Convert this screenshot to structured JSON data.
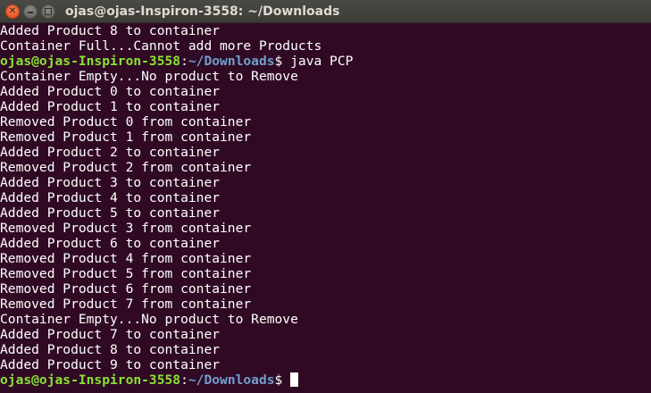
{
  "window": {
    "title": "ojas@ojas-Inspiron-3558: ~/Downloads",
    "close_glyph": "✕"
  },
  "prompt": {
    "user_host": "ojas@ojas-Inspiron-3558",
    "sep": ":",
    "path": "~/Downloads",
    "symbol": "$"
  },
  "lines": [
    {
      "type": "out",
      "text": "Added Product 8 to container"
    },
    {
      "type": "out",
      "text": "Container Full...Cannot add more Products"
    },
    {
      "type": "prompt",
      "command": " java PCP"
    },
    {
      "type": "out",
      "text": "Container Empty...No product to Remove"
    },
    {
      "type": "out",
      "text": "Added Product 0 to container"
    },
    {
      "type": "out",
      "text": "Added Product 1 to container"
    },
    {
      "type": "out",
      "text": "Removed Product 0 from container"
    },
    {
      "type": "out",
      "text": "Removed Product 1 from container"
    },
    {
      "type": "out",
      "text": "Added Product 2 to container"
    },
    {
      "type": "out",
      "text": "Removed Product 2 from container"
    },
    {
      "type": "out",
      "text": "Added Product 3 to container"
    },
    {
      "type": "out",
      "text": "Added Product 4 to container"
    },
    {
      "type": "out",
      "text": "Added Product 5 to container"
    },
    {
      "type": "out",
      "text": "Removed Product 3 from container"
    },
    {
      "type": "out",
      "text": "Added Product 6 to container"
    },
    {
      "type": "out",
      "text": "Removed Product 4 from container"
    },
    {
      "type": "out",
      "text": "Removed Product 5 from container"
    },
    {
      "type": "out",
      "text": "Removed Product 6 from container"
    },
    {
      "type": "out",
      "text": "Removed Product 7 from container"
    },
    {
      "type": "out",
      "text": "Container Empty...No product to Remove"
    },
    {
      "type": "out",
      "text": "Added Product 7 to container"
    },
    {
      "type": "out",
      "text": "Added Product 8 to container"
    },
    {
      "type": "out",
      "text": "Added Product 9 to container"
    },
    {
      "type": "prompt",
      "command": " ",
      "cursor": true
    }
  ],
  "colors": {
    "background": "#300a24",
    "text": "#ffffff",
    "prompt_user": "#8ae234",
    "prompt_path": "#729fcf",
    "close_button": "#e95420"
  }
}
